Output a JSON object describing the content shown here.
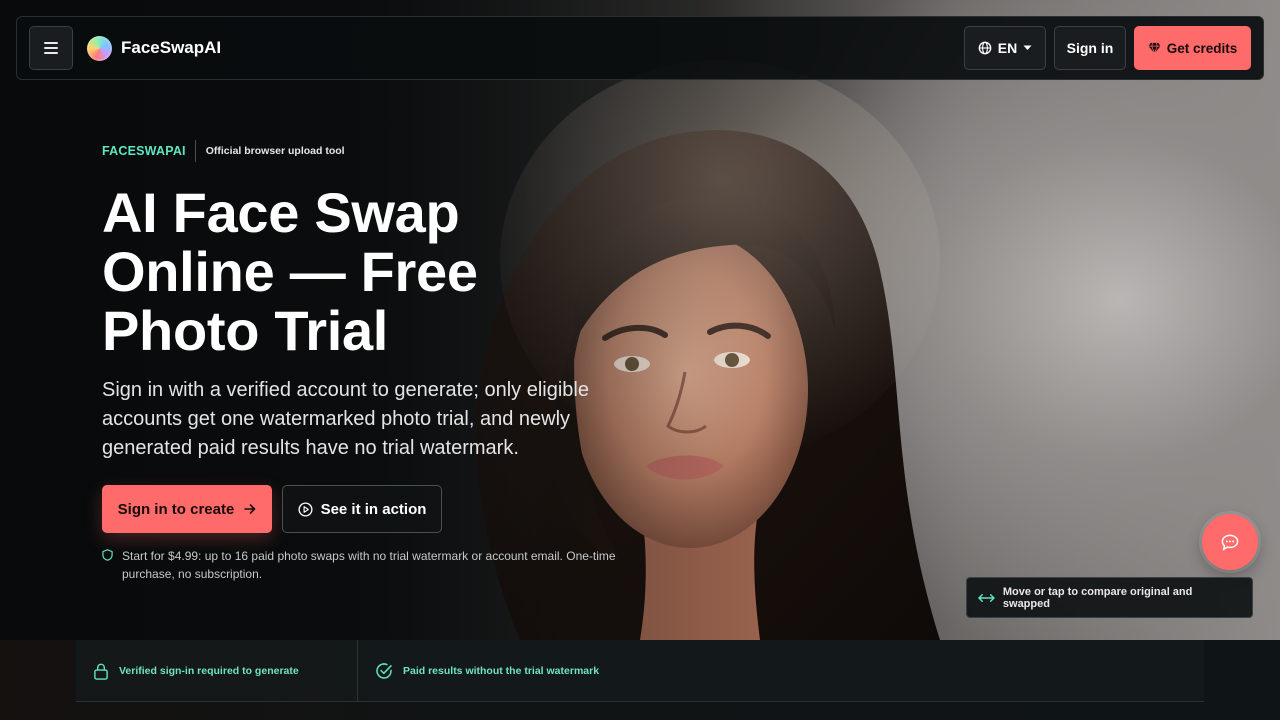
{
  "header": {
    "brand": "FaceSwapAI",
    "language": "EN",
    "sign_in": "Sign in",
    "get_credits": "Get credits"
  },
  "hero": {
    "eyebrow_brand": "FACESWAPAI",
    "eyebrow_note": "Official browser upload tool",
    "headline_lines": [
      "AI Face Swap",
      "Online — Free",
      "Photo Trial"
    ],
    "subhead": "Sign in with a verified account to generate; only eligible accounts get one watermarked photo trial, and newly generated paid results have no trial watermark.",
    "cta_primary": "Sign in to create",
    "cta_secondary": "See it in action",
    "pricing_note": "Start for $4.99: up to 16 paid photo swaps with no trial watermark or account email. One-time purchase, no subscription."
  },
  "compare_hint": "Move or tap to compare original and swapped",
  "features": [
    {
      "label": "Verified sign-in required to generate",
      "icon": "lock-icon"
    },
    {
      "label": "Paid results without the trial watermark",
      "icon": "check-circle-icon"
    }
  ],
  "colors": {
    "accent": "#ff6b6b",
    "teal": "#5ee6c3",
    "background": "#0c0f10"
  },
  "icons": {
    "menu": "hamburger-icon",
    "globe": "globe-icon",
    "chevron": "chevron-down-icon",
    "gem": "gem-icon",
    "arrow": "arrow-right-icon",
    "play": "play-circle-icon",
    "shield": "shield-icon",
    "chat": "chat-bubble-icon",
    "compare": "double-arrow-icon"
  }
}
